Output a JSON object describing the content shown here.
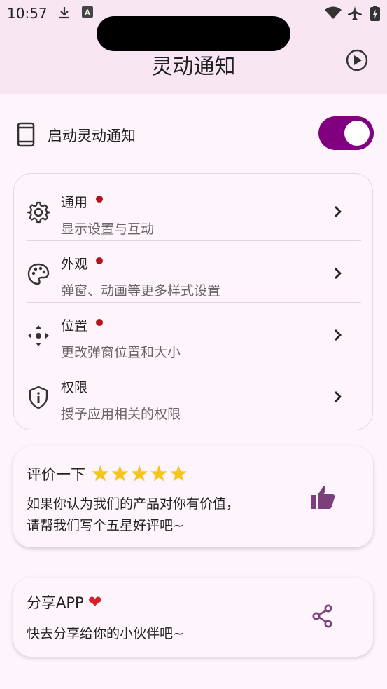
{
  "status_bar": {
    "time": "10:57",
    "icons": [
      "download-icon",
      "a-box-icon",
      "wifi-icon",
      "airplane-icon",
      "battery-icon"
    ]
  },
  "app_bar": {
    "title": "灵动通知",
    "action_icon": "play-circle-icon"
  },
  "enable": {
    "label": "启动灵动通知",
    "enabled": true,
    "icon": "phone-icon"
  },
  "settings": [
    {
      "title": "通用",
      "subtitle": "显示设置与互动",
      "icon": "gear-icon",
      "dot": true
    },
    {
      "title": "外观",
      "subtitle": "弹窗、动画等更多样式设置",
      "icon": "palette-icon",
      "dot": true
    },
    {
      "title": "位置",
      "subtitle": "更改弹窗位置和大小",
      "icon": "move-icon",
      "dot": true
    },
    {
      "title": "权限",
      "subtitle": "授予应用相关的权限",
      "icon": "shield-icon",
      "dot": false
    }
  ],
  "rate": {
    "title": "评价一下",
    "stars": "★★★★★",
    "line1": "如果你认为我们的产品对你有价值，",
    "line2": "请帮我们写个五星好评吧~",
    "icon": "thumbs-up-icon"
  },
  "share": {
    "title": "分享APP",
    "heart": "❤",
    "text": "快去分享给你的小伙伴吧~",
    "icon": "share-icon"
  },
  "colors": {
    "accent": "#800080",
    "app_bar_bg": "#f8e7f3",
    "page_bg": "#fdf5fb",
    "dot_red": "#b3141b",
    "star_gold": "#f5c518",
    "icon_purple": "#7b3f7b"
  }
}
